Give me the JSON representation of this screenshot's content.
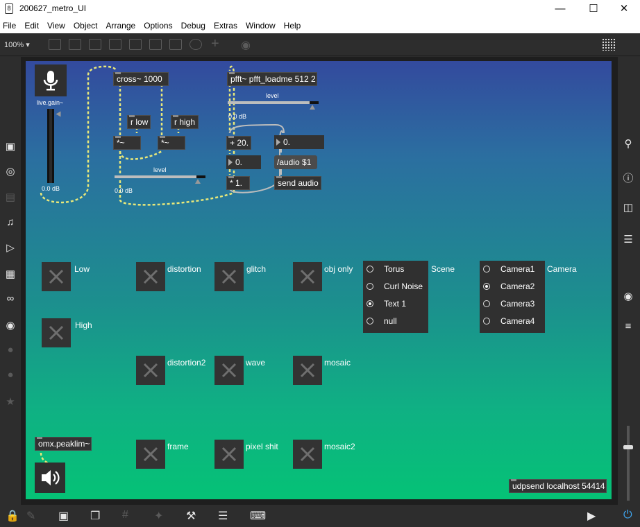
{
  "window": {
    "title": "200627_metro_UI",
    "icon": "max-app-icon",
    "controls": [
      "minimize",
      "maximize",
      "close"
    ]
  },
  "menu": [
    "File",
    "Edit",
    "View",
    "Object",
    "Arrange",
    "Options",
    "Debug",
    "Extras",
    "Window",
    "Help"
  ],
  "toolbar": {
    "zoom": "100%"
  },
  "patch": {
    "live_gain": {
      "label": "live.gain~",
      "value": "0.0 dB"
    },
    "cross": "cross~ 1000",
    "r_low": "r low",
    "r_high": "r high",
    "mul_a": "*~",
    "mul_b": "*~",
    "level_label_1": "level",
    "level_value_1": "0.0 dB",
    "pfft": "pfft~ pfft_loadme 512 2",
    "level_label_2": "level",
    "level_value_2": "0.0 dB",
    "plus20": "+ 20.",
    "num1": "0.",
    "num2": "0.",
    "mul1": "* 1.",
    "audio_msg": "/audio $1",
    "send_audio": "send audio",
    "omx": "omx.peaklim~",
    "udpsend": "udpsend localhost 54414"
  },
  "toggles": [
    {
      "label": "Low"
    },
    {
      "label": "High"
    },
    {
      "label": "distortion"
    },
    {
      "label": "distortion2"
    },
    {
      "label": "frame"
    },
    {
      "label": "glitch"
    },
    {
      "label": "wave"
    },
    {
      "label": "pixel shit"
    },
    {
      "label": "obj only"
    },
    {
      "label": "mosaic"
    },
    {
      "label": "mosaic2"
    }
  ],
  "scene_menu": {
    "label": "Scene",
    "items": [
      "Torus",
      "Curl Noise",
      "Text 1",
      "null"
    ],
    "selected": 2
  },
  "camera_menu": {
    "label": "Camera",
    "items": [
      "Camera1",
      "Camera2",
      "Camera3",
      "Camera4"
    ],
    "selected": 1
  },
  "colors": {
    "canvas_top": "#334a9e",
    "canvas_bottom": "#05c276",
    "object_bg": "#333333",
    "patchcord": "#e8e87a"
  }
}
